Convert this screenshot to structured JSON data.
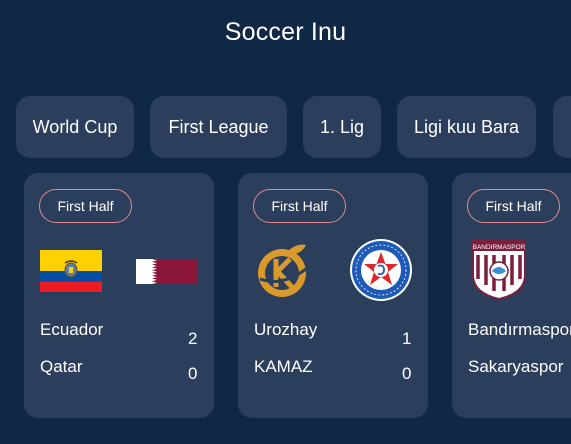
{
  "app": {
    "title": "Soccer Inu"
  },
  "leagues": [
    {
      "label": "World Cup"
    },
    {
      "label": "First League"
    },
    {
      "label": "1. Lig"
    },
    {
      "label": "Ligi kuu Bara"
    },
    {
      "label": ""
    }
  ],
  "matches": [
    {
      "status": "First Half",
      "home": {
        "name": "Ecuador",
        "score": "2",
        "logo": "ecuador-flag"
      },
      "away": {
        "name": "Qatar",
        "score": "0",
        "logo": "qatar-flag"
      }
    },
    {
      "status": "First Half",
      "home": {
        "name": "Urozhay",
        "score": "1",
        "logo": "urozhay-crest"
      },
      "away": {
        "name": "KAMAZ",
        "score": "0",
        "logo": "kamaz-crest"
      }
    },
    {
      "status": "First Half",
      "home": {
        "name": "Bandırmaspor",
        "logo": "bandirmaspor-crest",
        "crest_text": "BANDIRMASPOR"
      },
      "away": {
        "name": "Sakaryaspor"
      }
    }
  ],
  "colors": {
    "background": "#0f2846",
    "card": "#2b3e5c",
    "badge_border": "#e08a93",
    "text": "#ffffff"
  }
}
